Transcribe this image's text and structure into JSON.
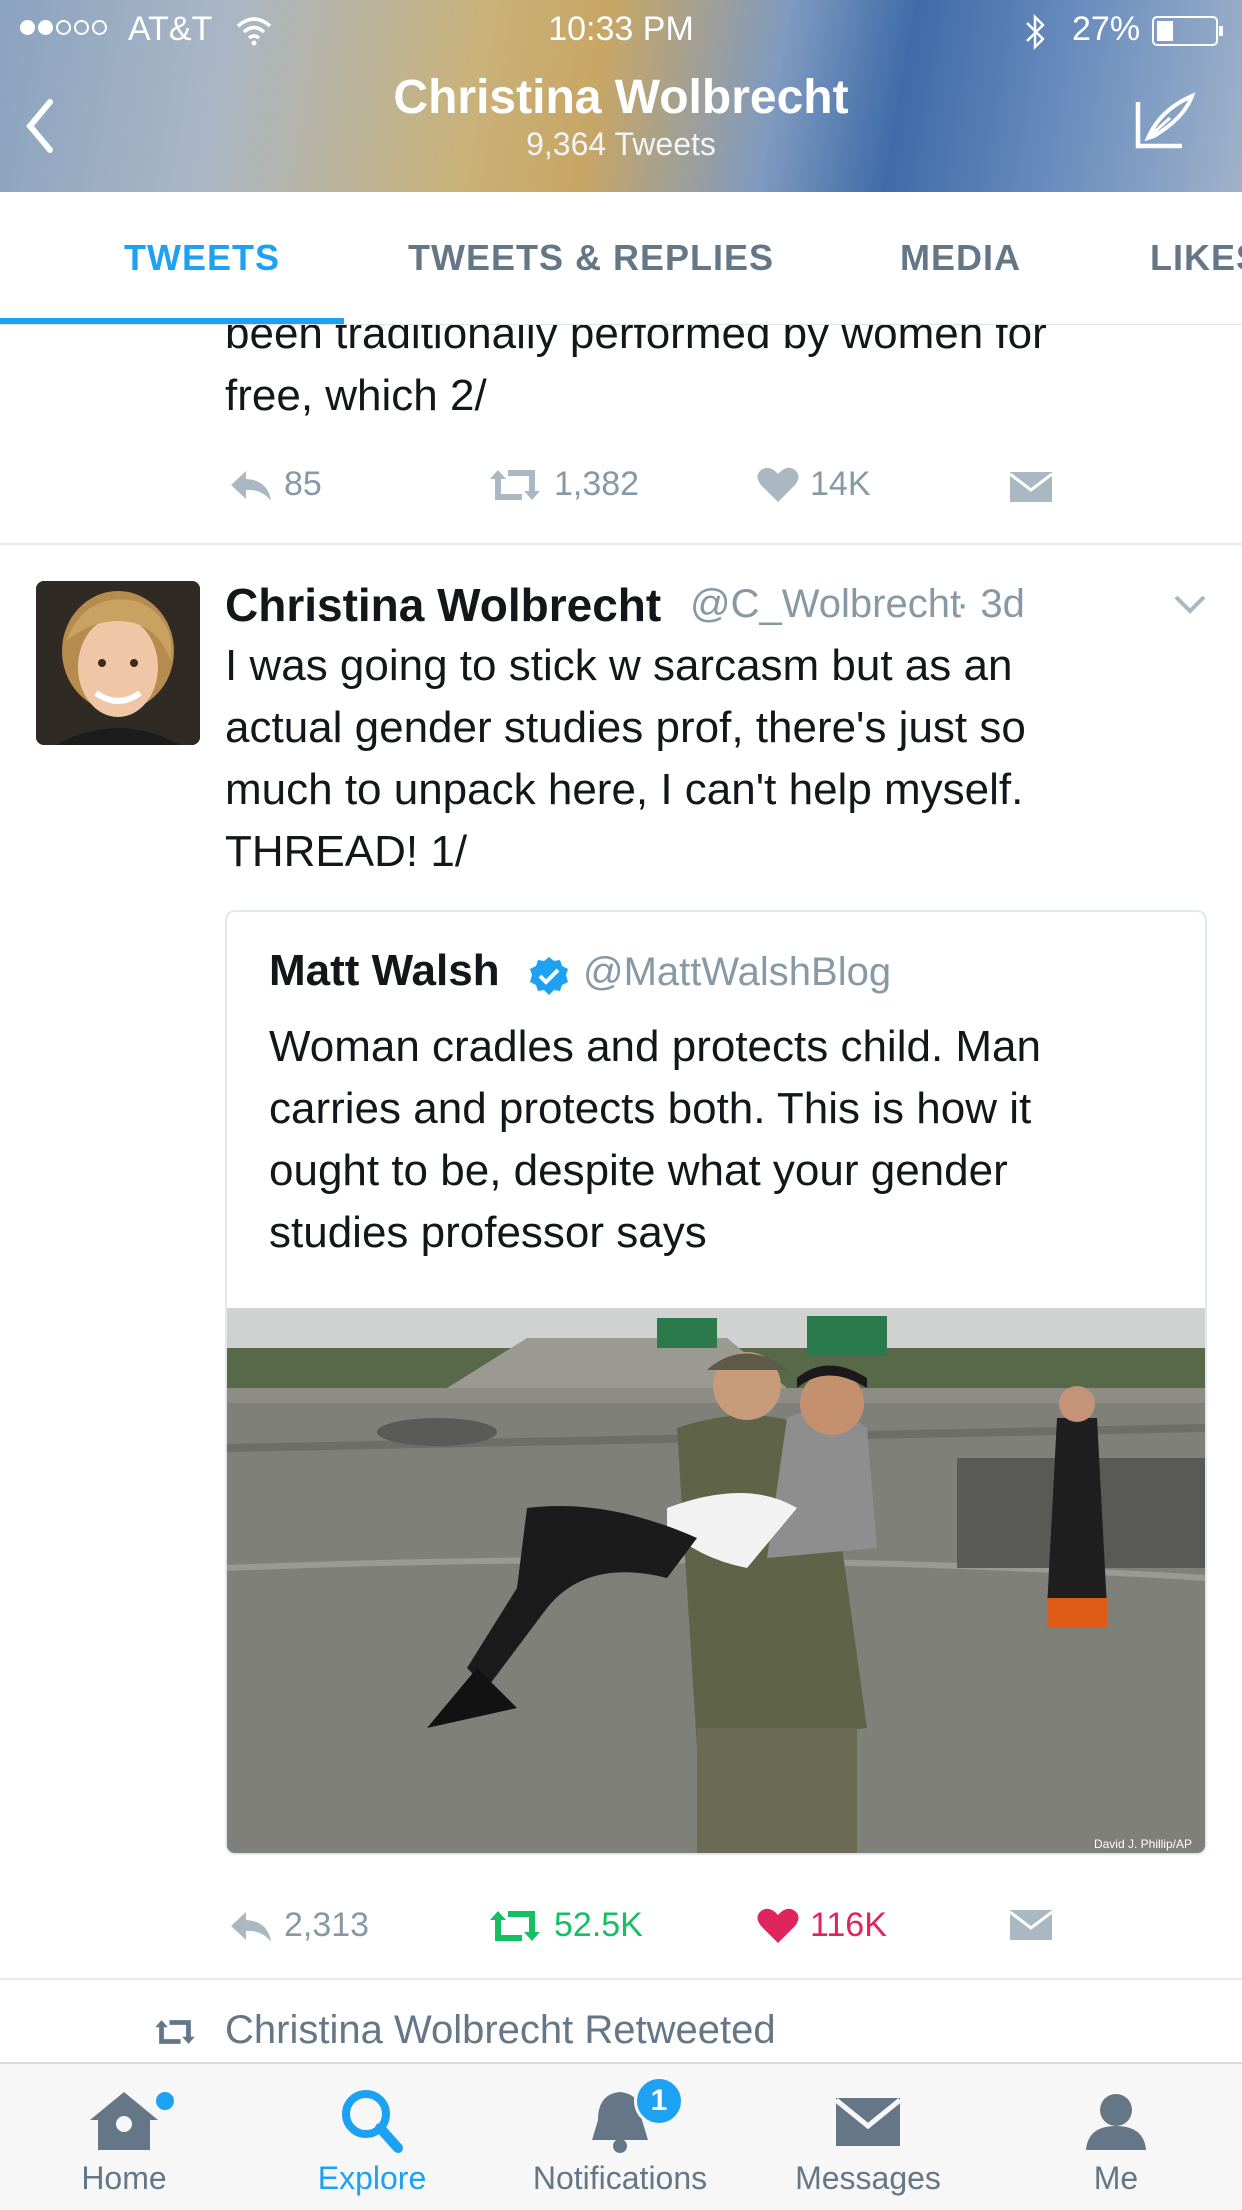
{
  "status_bar": {
    "carrier": "AT&T",
    "time": "10:33 PM",
    "battery": "27%"
  },
  "header": {
    "name": "Christina Wolbrecht",
    "tweet_count": "9,364 Tweets"
  },
  "tabs": [
    {
      "label": "TWEETS",
      "active": true
    },
    {
      "label": "TWEETS & REPLIES",
      "active": false
    },
    {
      "label": "MEDIA",
      "active": false
    },
    {
      "label": "LIKES",
      "active": false
    }
  ],
  "prev_tweet": {
    "line1": "been traditionally performed by women for",
    "line2": "free, which 2/",
    "replies": "85",
    "retweets": "1,382",
    "likes": "14K"
  },
  "tweet": {
    "name": "Christina Wolbrecht",
    "handle": "@C_Wolbrecht",
    "time": "· 3d",
    "lines": [
      "I was going to stick w sarcasm but as an",
      "actual gender studies prof, there's just so",
      "much to unpack here, I can't help myself.",
      "THREAD! 1/"
    ],
    "quoted": {
      "name": "Matt Walsh",
      "handle": "@MattWalshBlog",
      "lines": [
        "Woman cradles and protects child. Man",
        "carries and protects both. This is how it",
        "ought to be, despite what your gender",
        "studies professor says"
      ],
      "photo_credit": "David J. Phillip/AP"
    },
    "replies": "2,313",
    "retweets": "52.5K",
    "likes": "116K",
    "retweet_color": "#17bf63",
    "like_color": "#e0245e"
  },
  "retweeted_notice": "Christina Wolbrecht Retweeted",
  "nav": [
    {
      "label": "Home",
      "icon": "home-icon"
    },
    {
      "label": "Explore",
      "icon": "search-icon",
      "active": true
    },
    {
      "label": "Notifications",
      "icon": "bell-icon",
      "badge": "1"
    },
    {
      "label": "Messages",
      "icon": "envelope-icon"
    },
    {
      "label": "Me",
      "icon": "person-icon"
    }
  ],
  "accent_color": "#1da1f2"
}
